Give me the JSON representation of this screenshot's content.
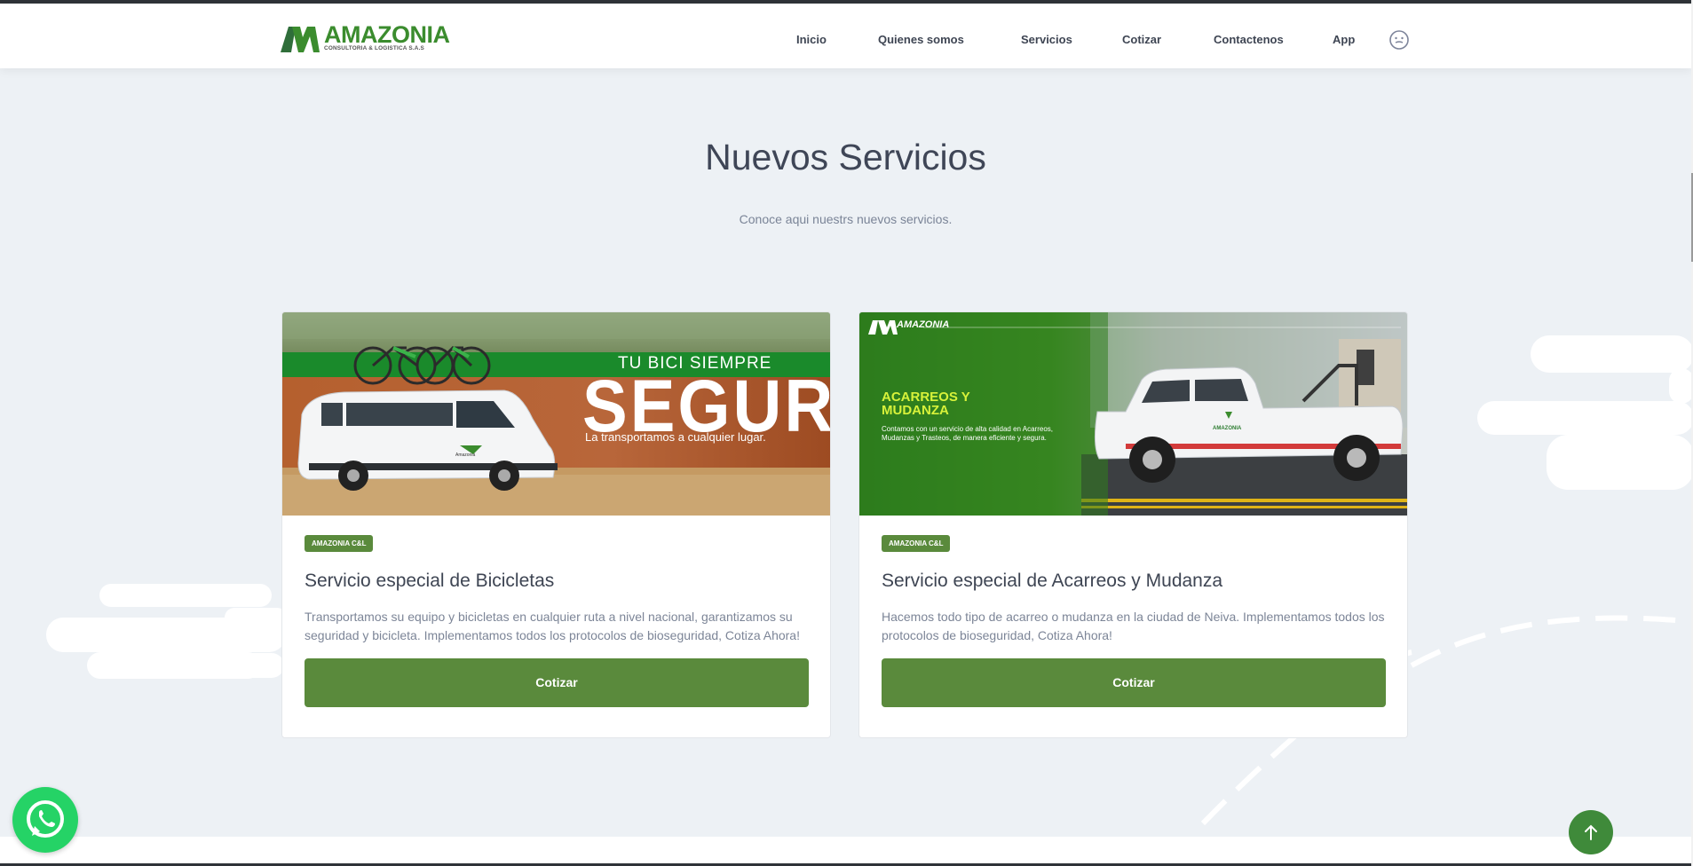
{
  "brand": {
    "name": "AMAZONIA",
    "tagline": "CONSULTORIA & LOGISTICA S.A.S",
    "color": "#3b8c2e"
  },
  "nav": {
    "items": [
      {
        "label": "Inicio"
      },
      {
        "label": "Quienes somos"
      },
      {
        "label": "Servicios"
      },
      {
        "label": "Cotizar"
      },
      {
        "label": "Contactenos"
      },
      {
        "label": "App"
      }
    ],
    "extra_icon": "smile-face-icon"
  },
  "section": {
    "title": "Nuevos Servicios",
    "subtitle": "Conoce aqui nuestrs nuevos servicios."
  },
  "cards": [
    {
      "image": {
        "headline_small": "TU BICI SIEMPRE",
        "headline_big": "SEGURA",
        "caption": "La transportamos a cualquier lugar.",
        "van_label": "Amazonia"
      },
      "badge": "AMAZONIA C&L",
      "title": "Servicio especial de Bicicletas",
      "text": "Transportamos su equipo y bicicletas en cualquier ruta a nivel nacional, garantizamos su seguridad y bicicleta. Implementamos todos los protocolos de bioseguridad, Cotiza Ahora!",
      "button": "Cotizar"
    },
    {
      "image": {
        "logo": "AMAZONIA",
        "headline": "ACARREOS Y MUDANZA",
        "body": "Contamos con  un servicio de alta calidad en Acarreos, Mudanzas y Trasteos, de manera eficiente y segura.",
        "truck_label": "AMAZONIA"
      },
      "badge": "AMAZONIA C&L",
      "title": "Servicio especial de Acarreos y Mudanza",
      "text": "Hacemos todo tipo de acarreo o mudanza en la ciudad de Neiva. Implementamos todos los protocolos de bioseguridad, Cotiza Ahora!",
      "button": "Cotizar"
    }
  ],
  "colors": {
    "accent": "#5a8a3c",
    "background": "#edf1f5",
    "whatsapp": "#25d366",
    "to_top": "#3f8a3a"
  },
  "floating": {
    "whatsapp_icon": "whatsapp-icon",
    "to_top_icon": "arrow-up-icon"
  }
}
